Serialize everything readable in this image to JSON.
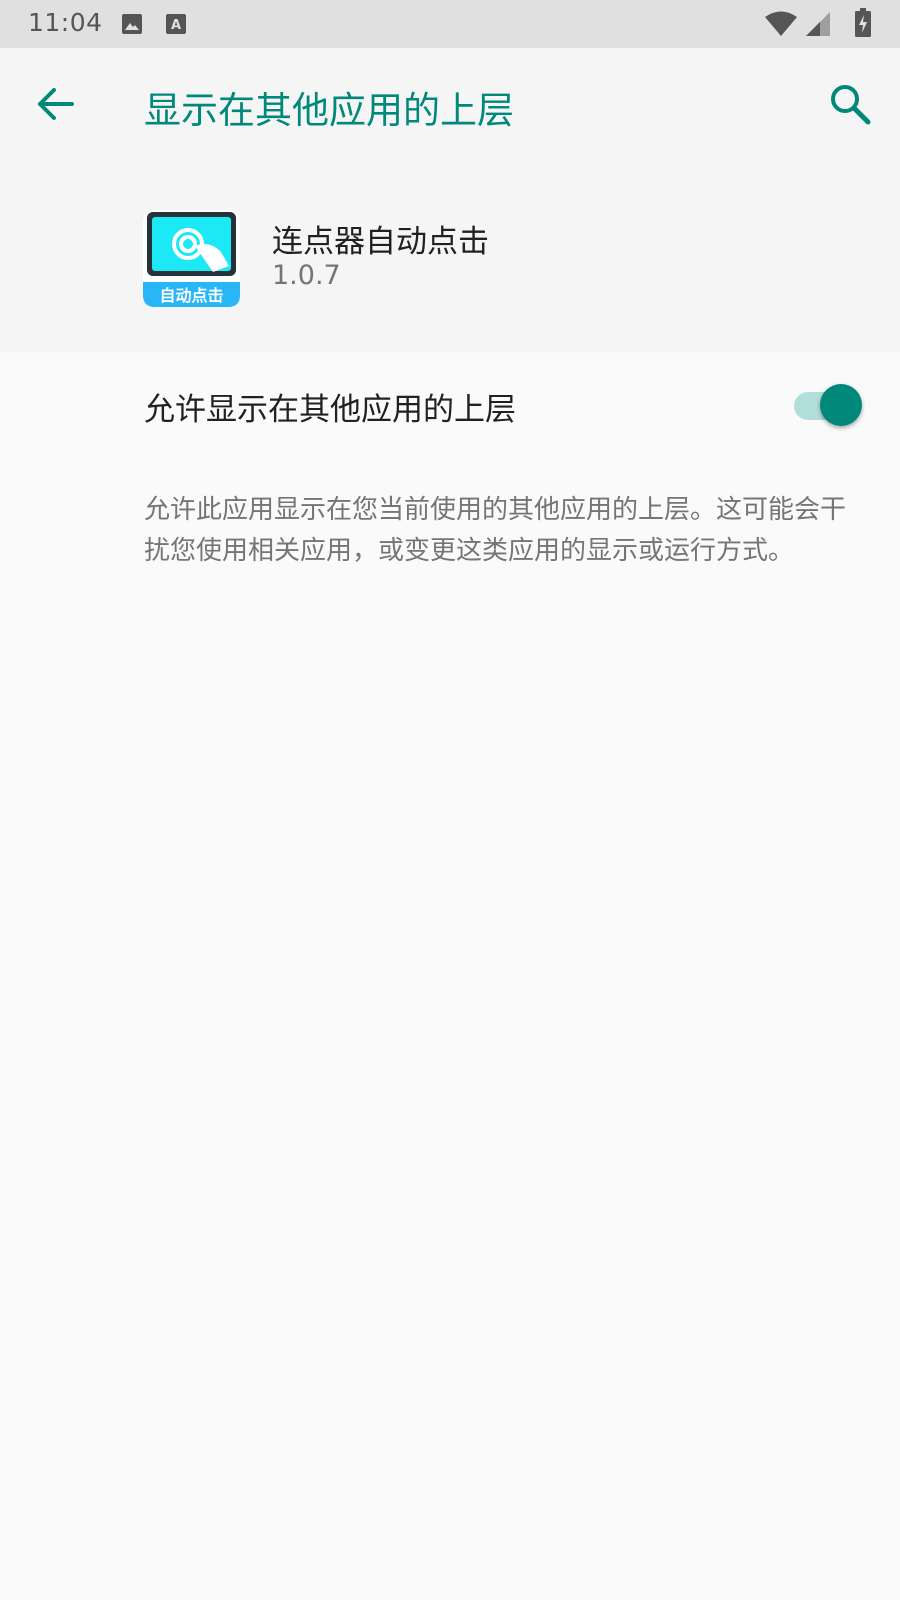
{
  "status_bar": {
    "time": "11:04",
    "left_icons": [
      "image-icon",
      "text-a-icon"
    ],
    "right_icons": [
      "wifi-icon",
      "signal-icon",
      "battery-icon"
    ]
  },
  "app_bar": {
    "title": "显示在其他应用的上层",
    "back_icon": "arrow-back-icon",
    "search_icon": "search-icon",
    "accent_color": "#00897b"
  },
  "app_info": {
    "name": "连点器自动点击",
    "version": "1.0.7",
    "icon_badge_text": "自动点击"
  },
  "setting": {
    "label": "允许显示在其他应用的上层",
    "enabled": true
  },
  "description": "允许此应用显示在您当前使用的其他应用的上层。这可能会干扰您使用相关应用，或变更这类应用的显示或运行方式。"
}
